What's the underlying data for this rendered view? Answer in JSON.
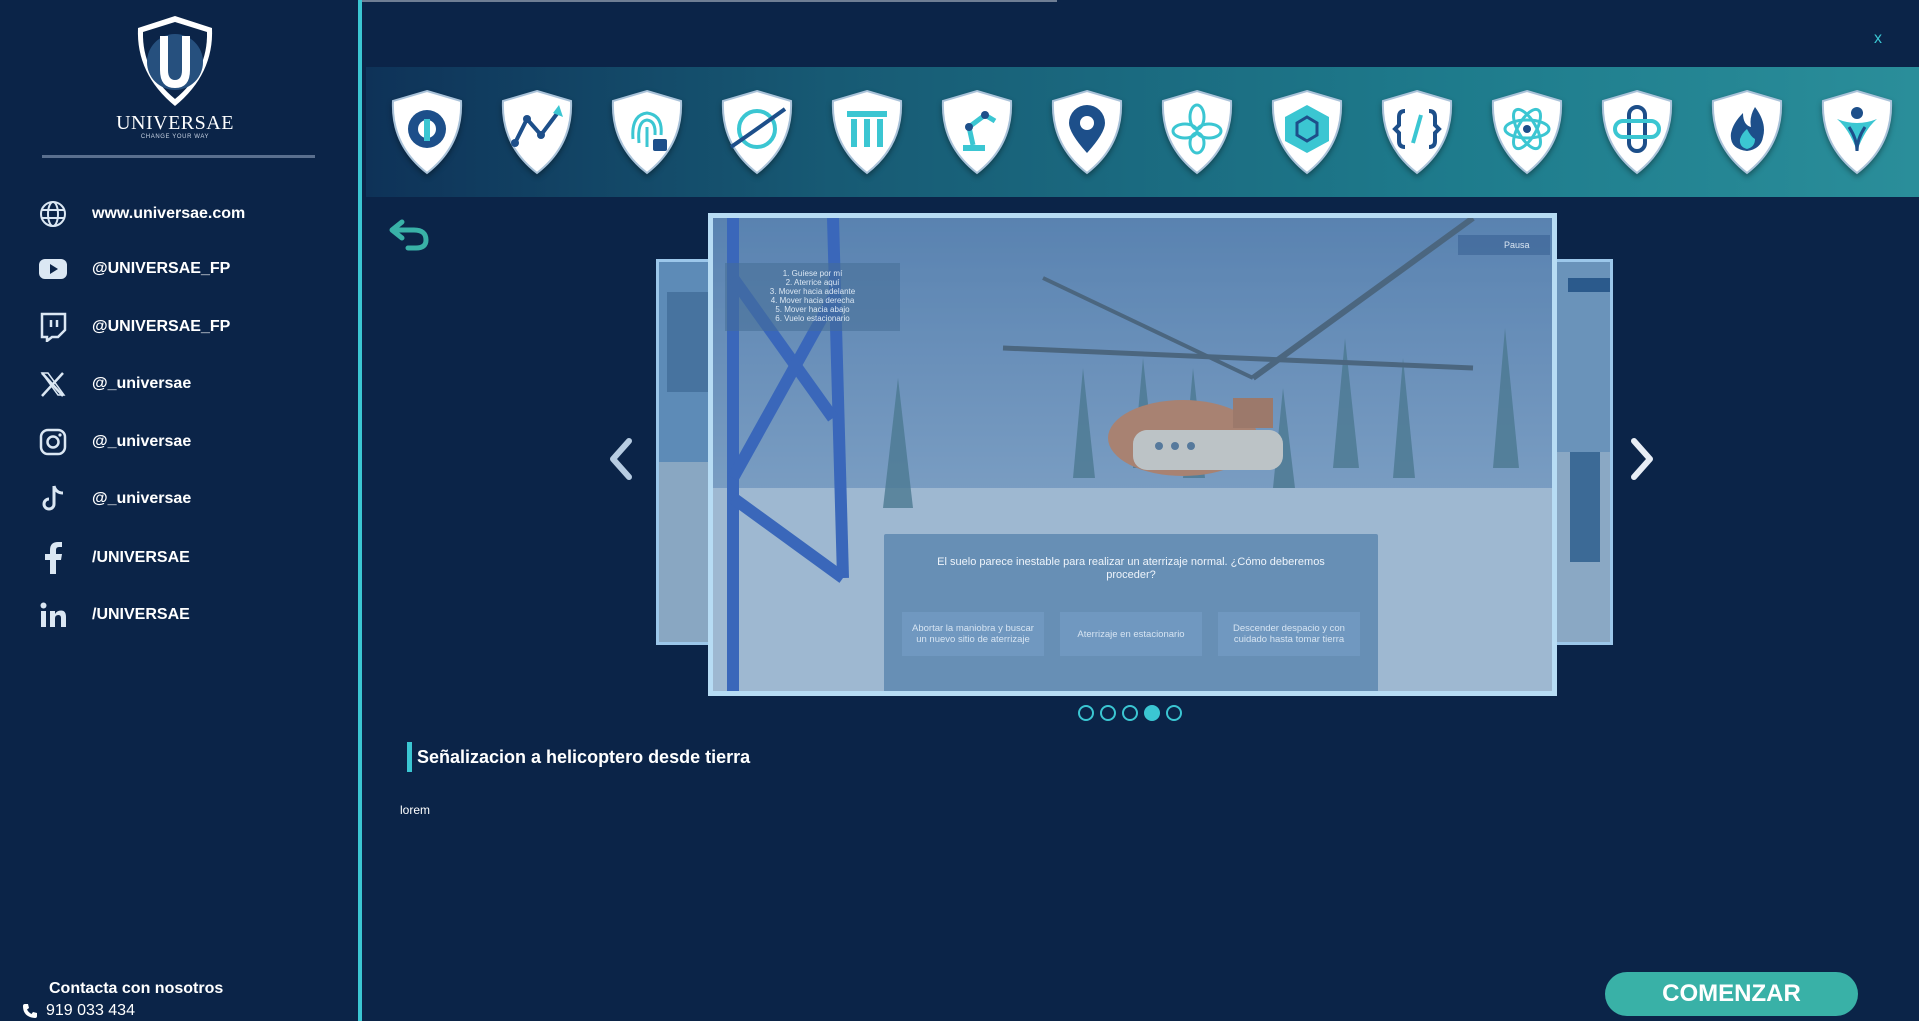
{
  "brand": {
    "name": "UNIVERSAE",
    "tagline": "CHANGE YOUR WAY"
  },
  "sidebar": {
    "links": [
      {
        "icon": "globe-icon",
        "label": "www.universae.com"
      },
      {
        "icon": "youtube-icon",
        "label": "@UNIVERSAE_FP"
      },
      {
        "icon": "twitch-icon",
        "label": "@UNIVERSAE_FP"
      },
      {
        "icon": "x-icon",
        "label": "@_universae"
      },
      {
        "icon": "instagram-icon",
        "label": "@_universae"
      },
      {
        "icon": "tiktok-icon",
        "label": "@_universae"
      },
      {
        "icon": "facebook-icon",
        "label": "/UNIVERSAE"
      },
      {
        "icon": "linkedin-icon",
        "label": "/UNIVERSAE"
      }
    ],
    "contact_title": "Contacta con nosotros",
    "contact_phone": "919 033 434"
  },
  "header": {
    "close_label": "x"
  },
  "badges": [
    "gear-wrench-icon",
    "chart-growth-icon",
    "fingerprint-lock-icon",
    "globe-orbit-icon",
    "columns-icon",
    "robot-arm-icon",
    "map-pin-icon",
    "flower-icon",
    "cube-icon",
    "code-brackets-icon",
    "atom-icon",
    "infinity-cross-icon",
    "flame-icon",
    "people-icon"
  ],
  "carousel": {
    "slide_count": 5,
    "active_index": 3,
    "hud": {
      "menu_lines": [
        "1. Guíese por mí",
        "2. Aterrice aquí",
        "3. Mover hacia adelante",
        "4. Mover hacia derecha",
        "5. Mover hacia abajo",
        "6. Vuelo estacionario"
      ],
      "pause_label": "Pausa",
      "question": "El suelo parece inestable para realizar un aterrizaje normal. ¿Cómo deberemos proceder?",
      "options": [
        "Abortar la maniobra y buscar un nuevo sitio de aterrizaje",
        "Aterrizaje en estacionario",
        "Descender despacio y con cuidado hasta tomar tierra"
      ],
      "right_pause_label": "Pausa"
    }
  },
  "content": {
    "title": "Señalizacion a helicoptero desde tierra",
    "description": "lorem"
  },
  "actions": {
    "start_label": "COMENZAR"
  },
  "colors": {
    "background": "#0b2448",
    "accent": "#3bc6d2",
    "button": "#39b1a7"
  }
}
